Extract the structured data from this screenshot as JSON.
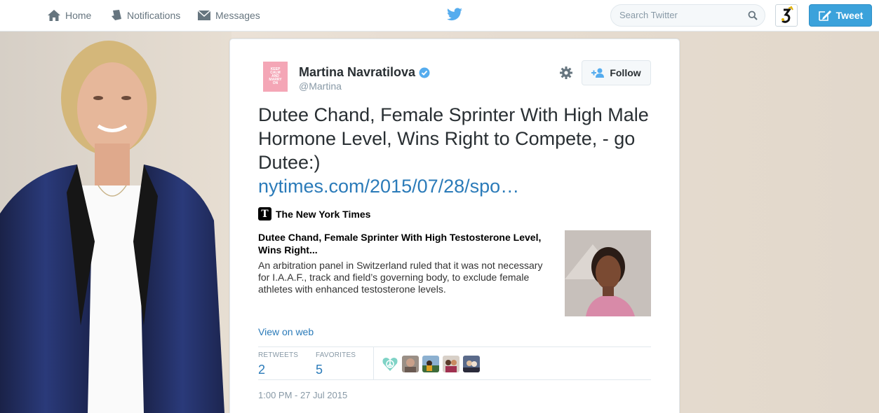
{
  "nav": {
    "home": "Home",
    "notifications": "Notifications",
    "messages": "Messages",
    "search_placeholder": "Search Twitter",
    "tweet_button": "Tweet"
  },
  "colors": {
    "accent": "#2b7bb9",
    "tweet_button": "#3ba2db",
    "verified": "#55acee",
    "bird": "#55acee"
  },
  "tweet": {
    "author": {
      "fullname": "Martina Navratilova",
      "username": "@Martina",
      "verified": true,
      "avatar_text": [
        "KEEP",
        "CALM",
        "AND",
        "MARRY",
        "ON"
      ]
    },
    "follow_label": "Follow",
    "text": "Dutee Chand, Female Sprinter With High Male Hormone Level, Wins Right to Compete, - go Dutee:)",
    "link": "nytimes.com/2015/07/28/spo…",
    "card": {
      "source": "The New York Times",
      "source_logo": "T",
      "title": "Dutee Chand, Female Sprinter With High Testosterone Level, Wins Right...",
      "description": "An arbitration panel in Switzerland ruled that it was not necessary for I.A.A.F., track and field’s governing body, to exclude female athletes with enhanced testosterone levels."
    },
    "view_on_web": "View on web",
    "stats": {
      "retweets_label": "RETWEETS",
      "retweets": "2",
      "favorites_label": "FAVORITES",
      "favorites": "5"
    },
    "timestamp": "1:00 PM - 27 Jul 2015"
  }
}
